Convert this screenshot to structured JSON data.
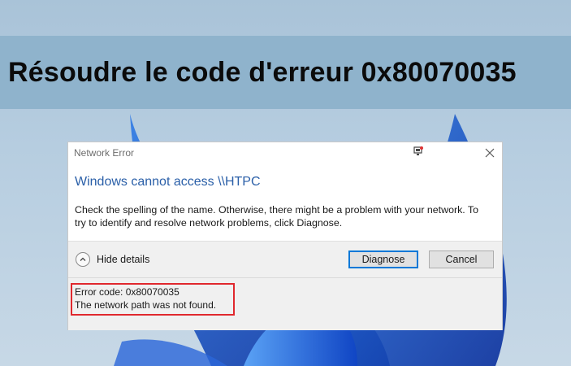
{
  "banner": {
    "title": "Résoudre le code d'erreur 0x80070035"
  },
  "dialog": {
    "title": "Network Error",
    "heading": "Windows cannot access \\\\HTPC",
    "message_line1": "Check the spelling of the name. Otherwise, there might be a problem with your network. To",
    "message_line2": "try to identify and resolve network problems, click Diagnose.",
    "hide_details_label": "Hide details",
    "diagnose_label": "Diagnose",
    "cancel_label": "Cancel",
    "error_code": "Error code: 0x80070035",
    "error_description": "The network path was not found."
  },
  "icons": {
    "title_icon": "network-icon",
    "close": "close-icon",
    "toggle": "chevron-up-icon"
  },
  "colors": {
    "banner": "#8fb3cc",
    "heading": "#2a5fa8",
    "highlight": "#e0282e",
    "accent": "#0078d7"
  }
}
